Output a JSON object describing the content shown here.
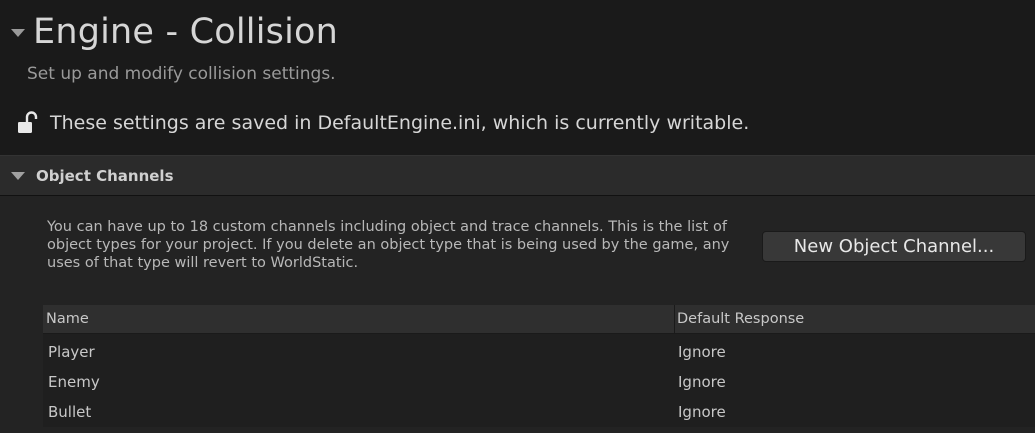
{
  "header": {
    "title": "Engine - Collision",
    "subtitle": "Set up and modify collision settings."
  },
  "save_notice": {
    "icon": "unlocked-padlock-icon",
    "text": "These settings are saved in DefaultEngine.ini, which is currently writable."
  },
  "section": {
    "title": "Object Channels",
    "description": "You can have up to 18 custom channels including object and trace channels. This is the list of object types for your project. If you delete an object type that is being used by the game, any uses of that type will revert to WorldStatic.",
    "new_button_label": "New Object Channel...",
    "table": {
      "columns": [
        "Name",
        "Default Response"
      ],
      "rows": [
        {
          "name": "Player",
          "response": "Ignore"
        },
        {
          "name": "Enemy",
          "response": "Ignore"
        },
        {
          "name": "Bullet",
          "response": "Ignore"
        }
      ]
    }
  },
  "colors": {
    "background": "#1a1a1a",
    "section_header": "#2b2b2b",
    "section_body": "#232323",
    "button": "#383838",
    "text_primary": "#d6d6d6",
    "text_secondary": "#9a9a9a"
  }
}
